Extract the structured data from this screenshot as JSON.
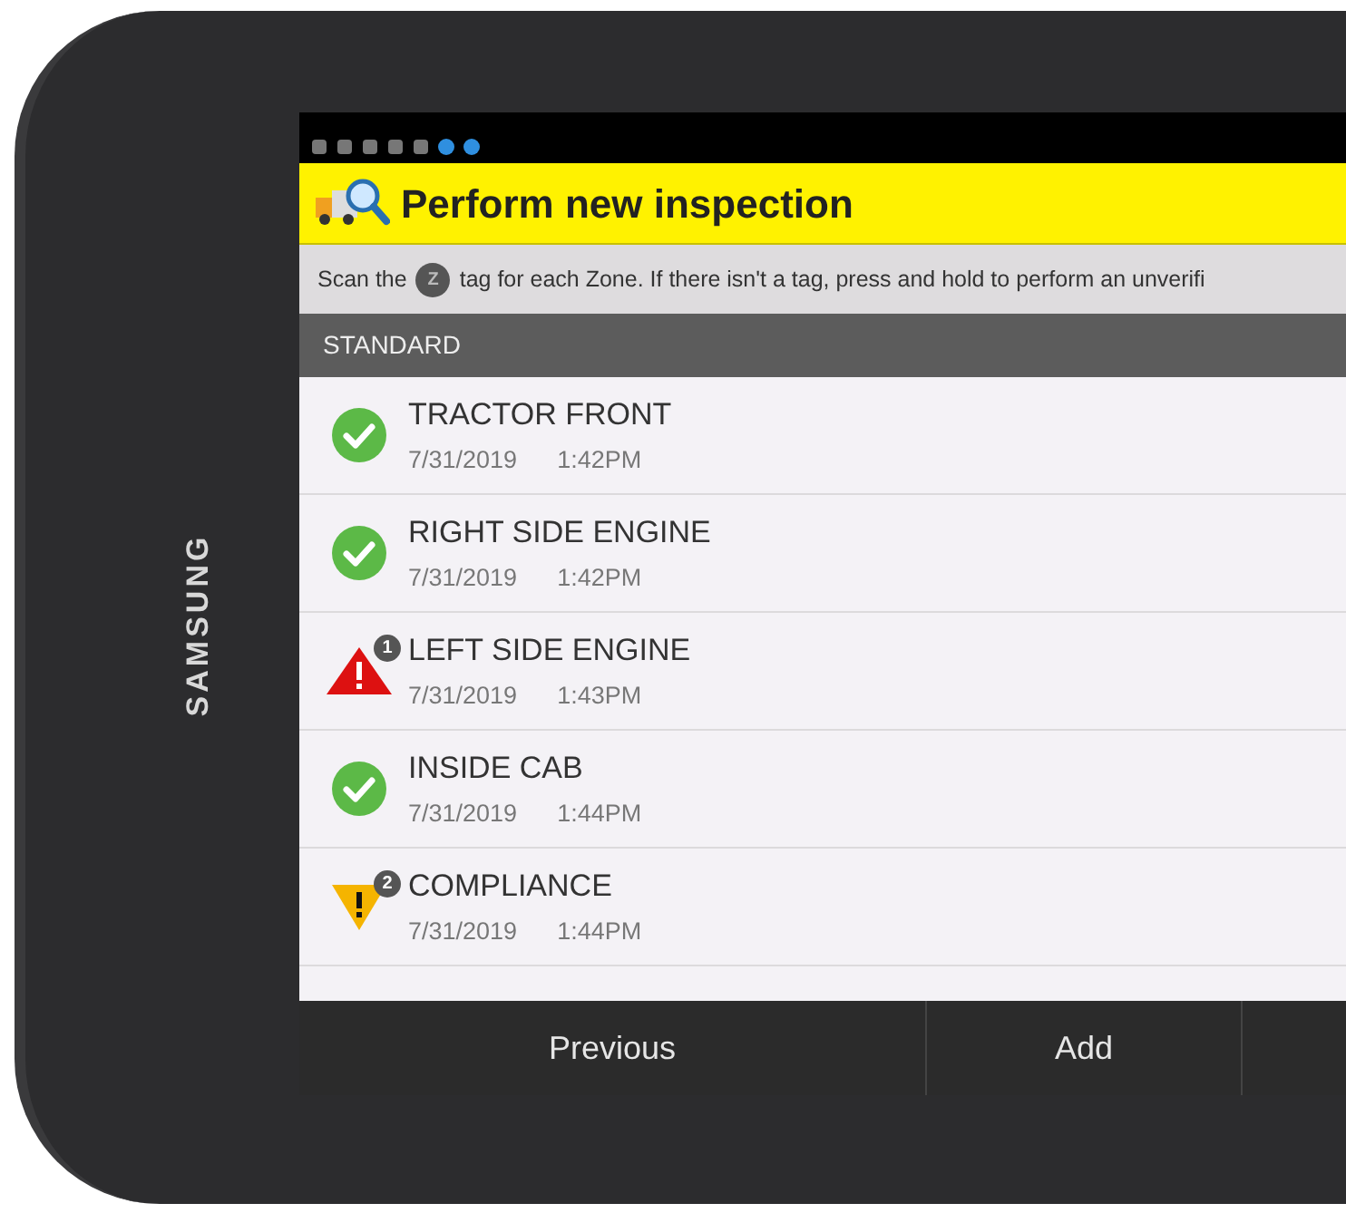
{
  "device": {
    "brand": "SAMSUNG"
  },
  "title_bar": {
    "title": "Perform new inspection"
  },
  "instruction": {
    "before": "Scan the",
    "tag_icon": "Z",
    "after": "tag for each Zone. If there isn't a tag, press and hold to perform an unverifi"
  },
  "section": {
    "title": "STANDARD"
  },
  "zones": [
    {
      "name": "TRACTOR FRONT",
      "date": "7/31/2019",
      "time": "1:42PM",
      "kind": "ok"
    },
    {
      "name": "RIGHT SIDE ENGINE",
      "date": "7/31/2019",
      "time": "1:42PM",
      "kind": "ok"
    },
    {
      "name": "LEFT SIDE ENGINE",
      "date": "7/31/2019",
      "time": "1:43PM",
      "kind": "defect",
      "count": "1"
    },
    {
      "name": "INSIDE CAB",
      "date": "7/31/2019",
      "time": "1:44PM",
      "kind": "ok"
    },
    {
      "name": "COMPLIANCE",
      "date": "7/31/2019",
      "time": "1:44PM",
      "kind": "warning",
      "count": "2"
    }
  ],
  "buttons": [
    "Previous",
    "Add"
  ]
}
